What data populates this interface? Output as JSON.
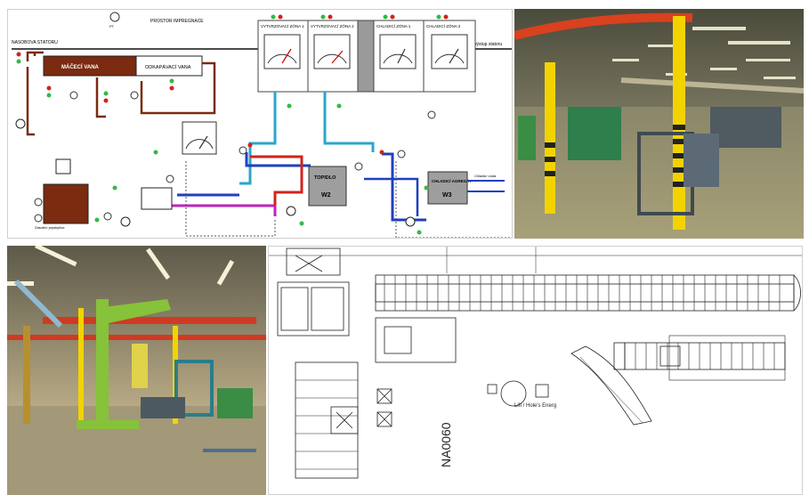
{
  "scheme": {
    "labels": {
      "tlak": "PT",
      "prostor": "PROSTOR IMPREGNACE",
      "studena": "NASOBOVA STATORU",
      "macaci": "MÁČECÍ VANA",
      "okapavaci": "ODKAPÁVACÍ VANA",
      "vytvr1": "VYTVRZOVACÍ ZÓNA 1",
      "vytvr2": "VYTVRZOVACÍ ZÓNA 2",
      "chlad1": "CHLADICÍ ZÓNA 1",
      "chlad2": "CHLADICÍ ZÓNA 2",
      "topidlo": "TOPIDLO",
      "w2": "W2",
      "chladici_agregat": "CHLADICÍ AGREGÁT",
      "w3": "W3",
      "chladici_voda": "Chladicí voda",
      "zasobni": "Zásobní pryskyřice",
      "vystup": "výstup statoru"
    }
  },
  "layout": {
    "label_na": "NA0060",
    "label_lift": "Lift / Hole's Energ"
  },
  "colors": {
    "brown": "#7a2b10",
    "red": "#d0241c",
    "blue": "#1f3fbf",
    "cyan": "#2aa6c9",
    "magenta": "#c023c0",
    "yellow": "#f2d300",
    "green": "#37b74a",
    "lime": "#86c23a"
  }
}
